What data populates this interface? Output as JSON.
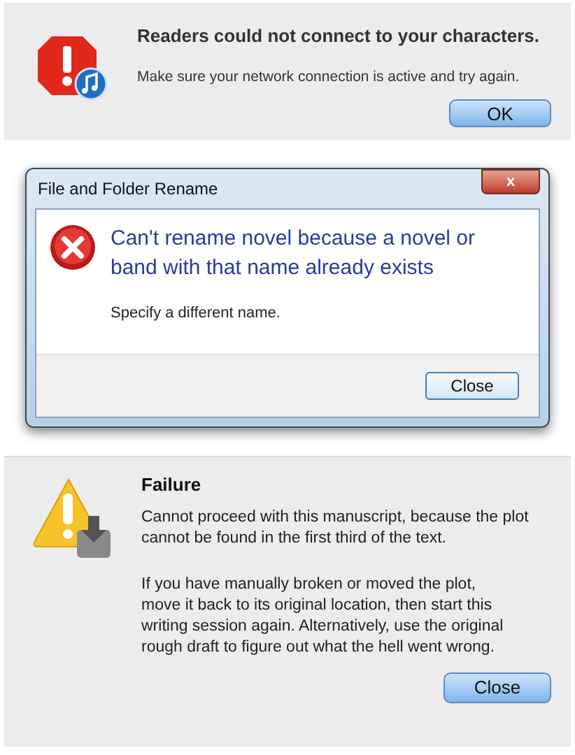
{
  "alert": {
    "title": "Readers could not connect to your characters.",
    "message": "Make sure your network connection is active and try again.",
    "button": "OK"
  },
  "rename_dialog": {
    "window_title": "File and Folder Rename",
    "close_glyph": "x",
    "heading": "Can't rename novel because a novel or band with that name already exists",
    "message": "Specify a different name.",
    "button": "Close"
  },
  "failure_dialog": {
    "title": "Failure",
    "message": "Cannot proceed with this manuscript, because the plot cannot be found in the first third of the text.",
    "detail": "If you have manually broken or moved the plot, move it back to its original location, then start this writing session again. Alternatively, use the original rough draft to figure out what the hell went wrong.",
    "button": "Close"
  }
}
